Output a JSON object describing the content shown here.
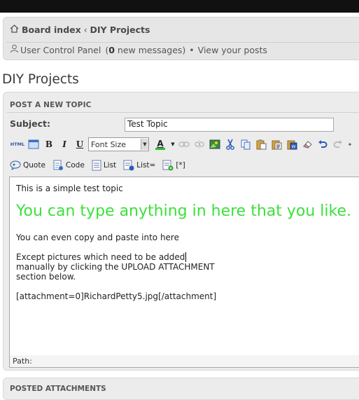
{
  "nav": {
    "board_index": "Board index",
    "separator": "‹",
    "forum": "DIY Projects",
    "ucp_link": "User Control Panel",
    "messages_count": "0",
    "messages_suffix": "new messages",
    "bullet": "•",
    "view_posts": "View your posts"
  },
  "page": {
    "title": "DIY Projects"
  },
  "form": {
    "section_title": "POST A NEW TOPIC",
    "subject_label": "Subject:",
    "subject_value": "Test Topic"
  },
  "toolbar": {
    "html_label": "HTML",
    "bold": "B",
    "italic": "I",
    "underline": "U",
    "font_size": "Font Size",
    "font_color": "A",
    "icons": [
      "link-icon",
      "unlink-icon",
      "image-icon",
      "cut-icon",
      "copy-icon",
      "paste-icon",
      "paste-text-icon",
      "paste-word-icon",
      "eraser-icon",
      "undo-icon",
      "redo-icon"
    ]
  },
  "toolbar2": {
    "quote": "Quote",
    "code": "Code",
    "list": "List",
    "list_ordered": "List=",
    "list_item": "[*]"
  },
  "editor": {
    "line1": "This is a simple test topic",
    "big_line": "You can type anything in here that you like.",
    "big_color": "#3de03d",
    "line3": "You can even copy and paste into here",
    "line4": "Except pictures which need to be added",
    "line5": "manually by clicking the UPLOAD ATTACHMENT",
    "line6": "section below.",
    "line7": "[attachment=0]RichardPetty5.jpg[/attachment]",
    "path_label": "Path:"
  },
  "attachments": {
    "title": "POSTED ATTACHMENTS"
  }
}
